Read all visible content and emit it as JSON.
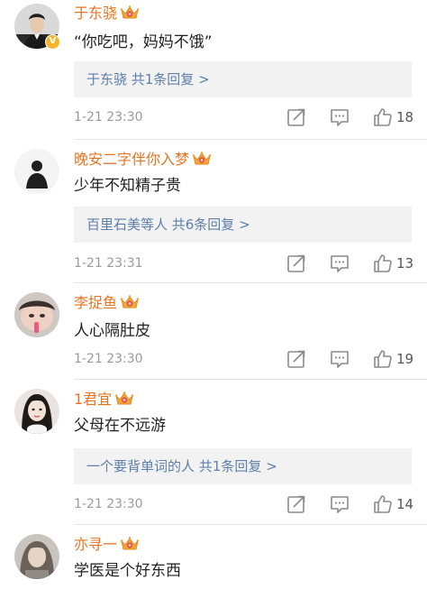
{
  "comments": [
    {
      "username": "于东骁",
      "verified_badge": "V",
      "text": "“你吃吧，妈妈不饿”",
      "reply_summary": "于东骁  共1条回复 >",
      "time": "1-21 23:30",
      "likes": "18"
    },
    {
      "username": "晚安二字伴你入梦",
      "text": "少年不知精子贵",
      "reply_summary": "百里石美等人  共6条回复 >",
      "time": "1-21 23:31",
      "likes": "13"
    },
    {
      "username": "李捉鱼",
      "text": "人心隔肚皮",
      "time": "1-21 23:30",
      "likes": "19"
    },
    {
      "username": "1君宜",
      "text": "父母在不远游",
      "reply_summary": "一个要背单词的人  共1条回复 >",
      "time": "1-21 23:30",
      "likes": "14"
    },
    {
      "username": "亦寻一",
      "text": "学医是个好东西"
    }
  ],
  "icons": {
    "repost": "repost-icon",
    "comment": "comment-icon",
    "like": "thumbs-up-icon",
    "member_badge": "crown-icon"
  },
  "colors": {
    "username": "#e57422",
    "reply_link": "#5d7fa8",
    "reply_bg": "#f2f2f2",
    "meta": "#9a9a9a",
    "text": "#222222"
  }
}
